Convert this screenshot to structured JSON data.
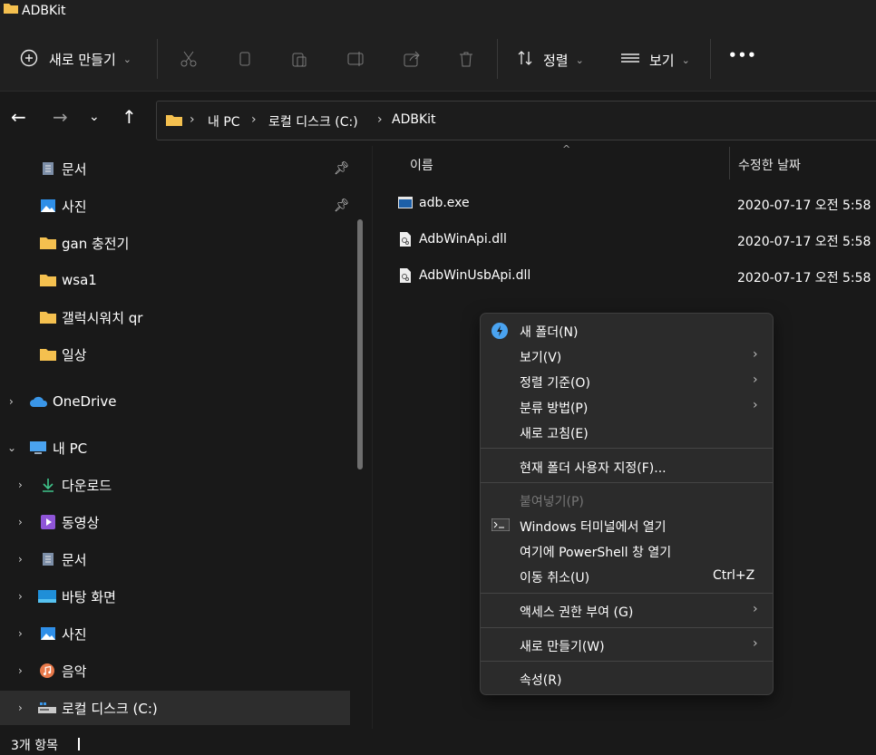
{
  "window": {
    "title": "ADBKit"
  },
  "toolbar": {
    "new_label": "새로 만들기",
    "sort_label": "정렬",
    "view_label": "보기",
    "more_label": "•••",
    "icons": [
      "cut-icon",
      "copy-icon",
      "paste-icon",
      "rename-icon",
      "share-icon",
      "delete-icon"
    ]
  },
  "address": {
    "crumbs": [
      "내 PC",
      "로컬 디스크 (C:)",
      "ADBKit"
    ],
    "separator": "›"
  },
  "sidebar": {
    "quick_items": [
      {
        "label": "문서",
        "icon": "document-icon",
        "pinned": true
      },
      {
        "label": "사진",
        "icon": "pictures-icon",
        "pinned": true
      },
      {
        "label": "gan 충전기",
        "icon": "folder-icon",
        "pinned": false
      },
      {
        "label": "wsa1",
        "icon": "folder-icon",
        "pinned": false
      },
      {
        "label": "갤럭시워치 qr",
        "icon": "folder-icon",
        "pinned": false
      },
      {
        "label": "일상",
        "icon": "folder-icon",
        "pinned": false
      }
    ],
    "onedrive": "OneDrive",
    "thispc": "내 PC",
    "pc_items": [
      {
        "label": "다운로드",
        "icon": "download-icon"
      },
      {
        "label": "동영상",
        "icon": "videos-icon"
      },
      {
        "label": "문서",
        "icon": "document-icon"
      },
      {
        "label": "바탕 화면",
        "icon": "desktop-icon"
      },
      {
        "label": "사진",
        "icon": "pictures-icon"
      },
      {
        "label": "음악",
        "icon": "music-icon"
      },
      {
        "label": "로컬 디스크 (C:)",
        "icon": "drive-icon"
      }
    ]
  },
  "files": {
    "col_name": "이름",
    "col_date": "수정한 날짜",
    "rows": [
      {
        "name": "adb.exe",
        "date": "2020-07-17 오전 5:58",
        "icon": "exe-icon"
      },
      {
        "name": "AdbWinApi.dll",
        "date": "2020-07-17 오전 5:58",
        "icon": "dll-icon"
      },
      {
        "name": "AdbWinUsbApi.dll",
        "date": "2020-07-17 오전 5:58",
        "icon": "dll-icon"
      }
    ]
  },
  "context_menu": {
    "new_folder": "새 폴더(N)",
    "view": "보기(V)",
    "sort_by": "정렬 기준(O)",
    "group_by": "분류 방법(P)",
    "refresh": "새로 고침(E)",
    "customize": "현재 폴더 사용자 지정(F)...",
    "paste": "붙여넣기(P)",
    "open_terminal": "Windows 터미널에서 열기",
    "open_powershell": "여기에 PowerShell 창 열기",
    "undo_move": "이동 취소(U)",
    "undo_shortcut": "Ctrl+Z",
    "give_access": "액세스 권한 부여 (G)",
    "new": "새로 만들기(W)",
    "properties": "속성(R)"
  },
  "status": {
    "count": "3개 항목"
  },
  "colors": {
    "background": "#191919",
    "chrome": "#202020",
    "menu": "#2b2b2b",
    "folder_yellow": "#f4c04f",
    "accent_blue": "#4aa3f0"
  }
}
